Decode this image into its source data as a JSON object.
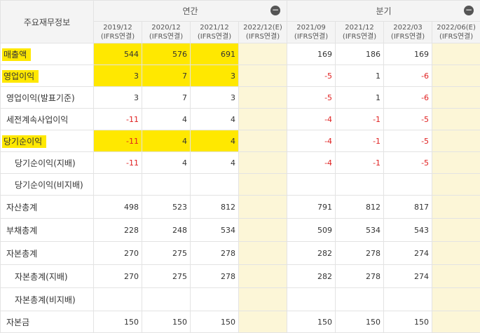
{
  "header": {
    "corner": "주요재무정보",
    "group_annual": "연간",
    "group_quarter": "분기",
    "toggle_symbol": "−",
    "periods": [
      {
        "date": "2019/12",
        "basis": "(IFRS연결)"
      },
      {
        "date": "2020/12",
        "basis": "(IFRS연결)"
      },
      {
        "date": "2021/12",
        "basis": "(IFRS연결)"
      },
      {
        "date": "2022/12(E)",
        "basis": "(IFRS연결)"
      },
      {
        "date": "2021/09",
        "basis": "(IFRS연결)"
      },
      {
        "date": "2021/12",
        "basis": "(IFRS연결)"
      },
      {
        "date": "2022/03",
        "basis": "(IFRS연결)"
      },
      {
        "date": "2022/06(E)",
        "basis": "(IFRS연결)"
      }
    ]
  },
  "rows": [
    {
      "label": "매출액",
      "values": [
        "544",
        "576",
        "691",
        "",
        "169",
        "186",
        "169",
        ""
      ]
    },
    {
      "label": "영업이익",
      "values": [
        "3",
        "7",
        "3",
        "",
        "-5",
        "1",
        "-6",
        ""
      ]
    },
    {
      "label": "영업이익(발표기준)",
      "values": [
        "3",
        "7",
        "3",
        "",
        "-5",
        "1",
        "-6",
        ""
      ]
    },
    {
      "label": "세전계속사업이익",
      "values": [
        "-11",
        "4",
        "4",
        "",
        "-4",
        "-1",
        "-5",
        ""
      ]
    },
    {
      "label": "당기순이익",
      "values": [
        "-11",
        "4",
        "4",
        "",
        "-4",
        "-1",
        "-5",
        ""
      ]
    },
    {
      "label": "당기순이익(지배)",
      "values": [
        "-11",
        "4",
        "4",
        "",
        "-4",
        "-1",
        "-5",
        ""
      ]
    },
    {
      "label": "당기순이익(비지배)",
      "values": [
        "",
        "",
        "",
        "",
        "",
        "",
        "",
        ""
      ]
    },
    {
      "label": "자산총계",
      "values": [
        "498",
        "523",
        "812",
        "",
        "791",
        "812",
        "817",
        ""
      ]
    },
    {
      "label": "부채총계",
      "values": [
        "228",
        "248",
        "534",
        "",
        "509",
        "534",
        "543",
        ""
      ]
    },
    {
      "label": "자본총계",
      "values": [
        "270",
        "275",
        "278",
        "",
        "282",
        "278",
        "274",
        ""
      ]
    },
    {
      "label": "자본총계(지배)",
      "values": [
        "270",
        "275",
        "278",
        "",
        "282",
        "278",
        "274",
        ""
      ]
    },
    {
      "label": "자본총계(비지배)",
      "values": [
        "",
        "",
        "",
        "",
        "",
        "",
        "",
        ""
      ]
    },
    {
      "label": "자본금",
      "values": [
        "150",
        "150",
        "150",
        "",
        "150",
        "150",
        "150",
        ""
      ]
    }
  ],
  "colors": {
    "highlight": "#ffe800",
    "negative": "#e02020",
    "estimate_column": "#fcf6d7"
  }
}
